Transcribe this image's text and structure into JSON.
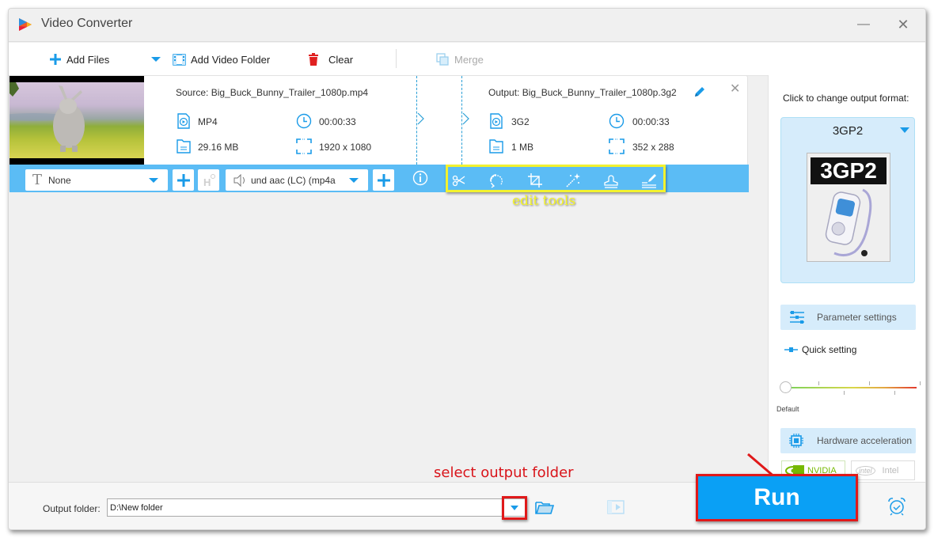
{
  "window": {
    "title": "Video Converter",
    "minimize_label": "—",
    "close_label": "✕"
  },
  "toolbar": {
    "add_files": "Add Files",
    "add_video_folder": "Add Video Folder",
    "clear": "Clear",
    "merge": "Merge"
  },
  "task": {
    "source_label": "Source: Big_Buck_Bunny_Trailer_1080p.mp4",
    "source": {
      "format": "MP4",
      "duration": "00:00:33",
      "size": "29.16 MB",
      "resolution": "1920 x 1080"
    },
    "output_label": "Output: Big_Buck_Bunny_Trailer_1080p.3g2",
    "output": {
      "format": "3G2",
      "duration": "00:00:33",
      "size": "1 MB",
      "resolution": "352 x 288"
    },
    "subtitle_select": "None",
    "audio_select": "und aac (LC) (mp4a",
    "edit_tools": [
      "trim",
      "rotate",
      "crop",
      "effects",
      "watermark",
      "subtitle-edit"
    ]
  },
  "annotations": {
    "edit_tools": "edit tools",
    "select_output_folder": "select output folder"
  },
  "right_panel": {
    "change_format_label": "Click to change output format:",
    "format_name": "3GP2",
    "format_image_text": "3GP2",
    "parameter_settings": "Parameter settings",
    "quick_setting": "Quick setting",
    "quality_slider_label": "Default",
    "quality_slider_value": 0,
    "hardware_acceleration": "Hardware acceleration",
    "nvidia": "NVIDIA",
    "intel": "Intel",
    "intel_logo": "intel"
  },
  "bottom": {
    "output_folder_label": "Output folder:",
    "output_folder_value": "D:\\New folder",
    "run": "Run"
  },
  "colors": {
    "accent": "#1a9be8",
    "task_bar": "#5bbcf5",
    "run_button": "#0aa0f5",
    "annotation_red": "#e0191a",
    "annotation_yellow": "#f2f22e"
  }
}
